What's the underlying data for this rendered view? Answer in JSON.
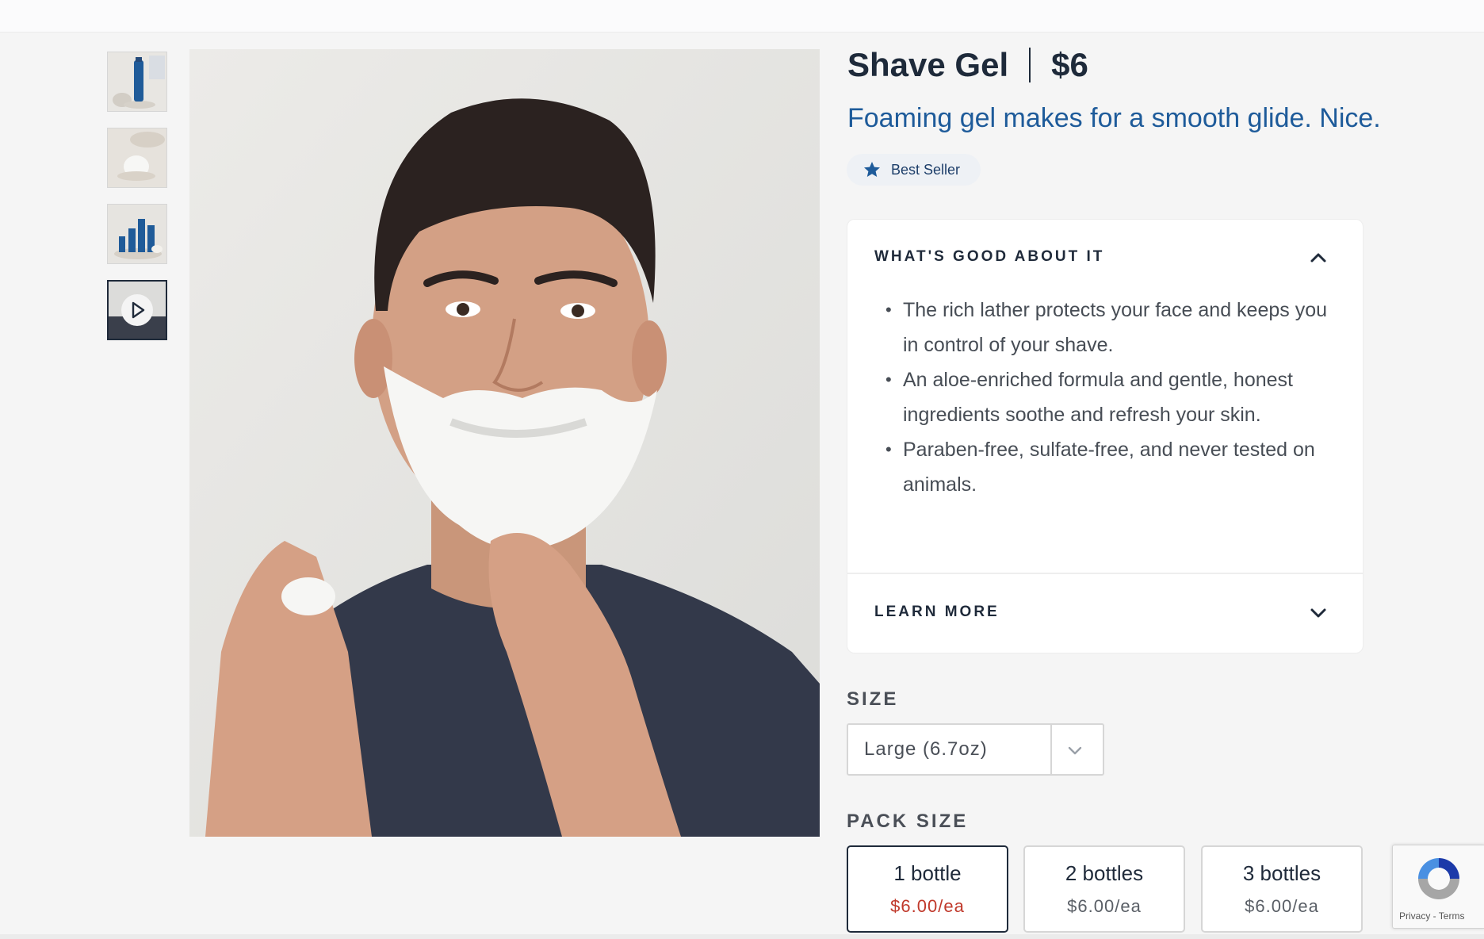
{
  "product": {
    "name": "Shave Gel",
    "price": "$6",
    "tagline": "Foaming gel makes for a smooth glide. Nice.",
    "badge": "Best Seller"
  },
  "accordion": {
    "whats_good": {
      "title": "WHAT'S GOOD ABOUT IT",
      "expanded": true,
      "bullets": [
        "The rich lather protects your face and keeps you in control of your shave.",
        "An aloe-enriched formula and gentle, honest ingredients soothe and refresh your skin.",
        "Paraben-free, sulfate-free, and never tested on animals."
      ]
    },
    "learn_more": {
      "title": "LEARN MORE",
      "expanded": false
    }
  },
  "size": {
    "label": "SIZE",
    "selected": "Large (6.7oz)"
  },
  "pack_size": {
    "label": "PACK SIZE",
    "selected_index": 0,
    "options": [
      {
        "qty": "1 bottle",
        "price": "$6.00/ea"
      },
      {
        "qty": "2 bottles",
        "price": "$6.00/ea"
      },
      {
        "qty": "3 bottles",
        "price": "$6.00/ea"
      }
    ]
  },
  "recaptcha": {
    "text": "Privacy - Terms"
  },
  "colors": {
    "brand_navy": "#1e2a3a",
    "tagline_blue": "#1e5b9a",
    "selected_price_red": "#c0392b"
  },
  "icons": {
    "badge": "star-icon",
    "whats_good_toggle": "chevron-up-icon",
    "learn_more_toggle": "chevron-down-icon",
    "size_dropdown": "chevron-down-icon",
    "video_thumb": "play-icon"
  }
}
